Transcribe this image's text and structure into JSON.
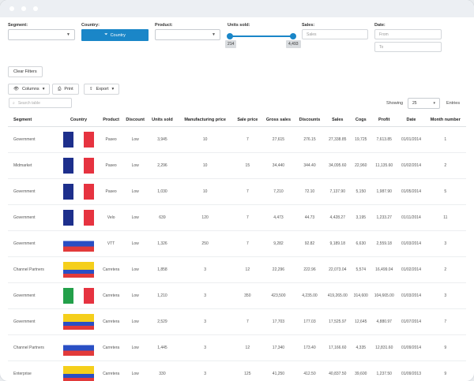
{
  "filters": {
    "segment_label": "Segment:",
    "country_label": "Country:",
    "country_button": "Country",
    "product_label": "Product:",
    "units_label": "Units sold:",
    "units_min": "214",
    "units_max": "4,493",
    "sales_label": "Sales:",
    "sales_placeholder": "Sales",
    "date_label": "Date:",
    "date_from": "From",
    "date_to": "To"
  },
  "toolbar": {
    "clear_filters": "Clear Filters",
    "columns": "Columns",
    "print": "Print",
    "export": "Export"
  },
  "search": {
    "placeholder": "Search table"
  },
  "paging": {
    "showing_label": "Showing",
    "page_size": "25",
    "entries_label": "Entries"
  },
  "columns": [
    "Segment",
    "Country",
    "Product",
    "Discount",
    "Units sold",
    "Manufacturing price",
    "Sale price",
    "Gross sales",
    "Discounts",
    "Sales",
    "Cogs",
    "Profit",
    "Date",
    "Month number"
  ],
  "rows": [
    {
      "segment": "Government",
      "flag": "france",
      "product": "Paseo",
      "discount": "Low",
      "units": "3,945",
      "mfg": "10",
      "price": "7",
      "gross": "27,615",
      "discounts": "276.15",
      "sales": "27,338.85",
      "cogs": "19,725",
      "profit": "7,613.85",
      "date": "01/01/2014",
      "month": "1"
    },
    {
      "segment": "Midmarket",
      "flag": "france",
      "product": "Paseo",
      "discount": "Low",
      "units": "2,296",
      "mfg": "10",
      "price": "15",
      "gross": "34,440",
      "discounts": "344.40",
      "sales": "34,095.60",
      "cogs": "22,960",
      "profit": "11,135.60",
      "date": "01/02/2014",
      "month": "2"
    },
    {
      "segment": "Government",
      "flag": "france",
      "product": "Paseo",
      "discount": "Low",
      "units": "1,030",
      "mfg": "10",
      "price": "7",
      "gross": "7,210",
      "discounts": "72.10",
      "sales": "7,137.90",
      "cogs": "5,150",
      "profit": "1,987.90",
      "date": "01/05/2014",
      "month": "5"
    },
    {
      "segment": "Government",
      "flag": "france",
      "product": "Velo",
      "discount": "Low",
      "units": "639",
      "mfg": "120",
      "price": "7",
      "gross": "4,473",
      "discounts": "44.73",
      "sales": "4,428.27",
      "cogs": "3,195",
      "profit": "1,233.27",
      "date": "01/11/2014",
      "month": "11"
    },
    {
      "segment": "Government",
      "flag": "russia",
      "product": "VTT",
      "discount": "Low",
      "units": "1,326",
      "mfg": "250",
      "price": "7",
      "gross": "9,282",
      "discounts": "92.82",
      "sales": "9,189.18",
      "cogs": "6,630",
      "profit": "2,559.18",
      "date": "01/03/2014",
      "month": "3"
    },
    {
      "segment": "Channel Partners",
      "flag": "colombia",
      "product": "Carretera",
      "discount": "Low",
      "units": "1,858",
      "mfg": "3",
      "price": "12",
      "gross": "22,296",
      "discounts": "222.96",
      "sales": "22,073.04",
      "cogs": "5,574",
      "profit": "16,499.04",
      "date": "01/02/2014",
      "month": "2"
    },
    {
      "segment": "Government",
      "flag": "italy",
      "product": "Carretera",
      "discount": "Low",
      "units": "1,210",
      "mfg": "3",
      "price": "350",
      "gross": "423,500",
      "discounts": "4,235.00",
      "sales": "419,265.00",
      "cogs": "314,600",
      "profit": "104,665.00",
      "date": "01/03/2014",
      "month": "3"
    },
    {
      "segment": "Government",
      "flag": "colombia",
      "product": "Carretera",
      "discount": "Low",
      "units": "2,529",
      "mfg": "3",
      "price": "7",
      "gross": "17,703",
      "discounts": "177.03",
      "sales": "17,525.97",
      "cogs": "12,645",
      "profit": "4,880.97",
      "date": "01/07/2014",
      "month": "7"
    },
    {
      "segment": "Channel Partners",
      "flag": "russia",
      "product": "Carretera",
      "discount": "Low",
      "units": "1,445",
      "mfg": "3",
      "price": "12",
      "gross": "17,340",
      "discounts": "173.40",
      "sales": "17,166.60",
      "cogs": "4,335",
      "profit": "12,831.60",
      "date": "01/09/2014",
      "month": "9"
    },
    {
      "segment": "Enterprise",
      "flag": "colombia",
      "product": "Carretera",
      "discount": "Low",
      "units": "330",
      "mfg": "3",
      "price": "125",
      "gross": "41,250",
      "discounts": "412.50",
      "sales": "40,837.50",
      "cogs": "39,600",
      "profit": "1,237.50",
      "date": "01/09/2013",
      "month": "9"
    }
  ],
  "flag_colors": {
    "france": [
      "#1d2f8c",
      "#ffffff",
      "#e63340"
    ],
    "italy": [
      "#23a04a",
      "#ffffff",
      "#e63340"
    ],
    "russia": [
      "#ffffff",
      "#2a4fc4",
      "#e23a3a"
    ],
    "colombia": [
      "#f5cf1b",
      "#2a4fc4",
      "#e23a3a"
    ]
  }
}
